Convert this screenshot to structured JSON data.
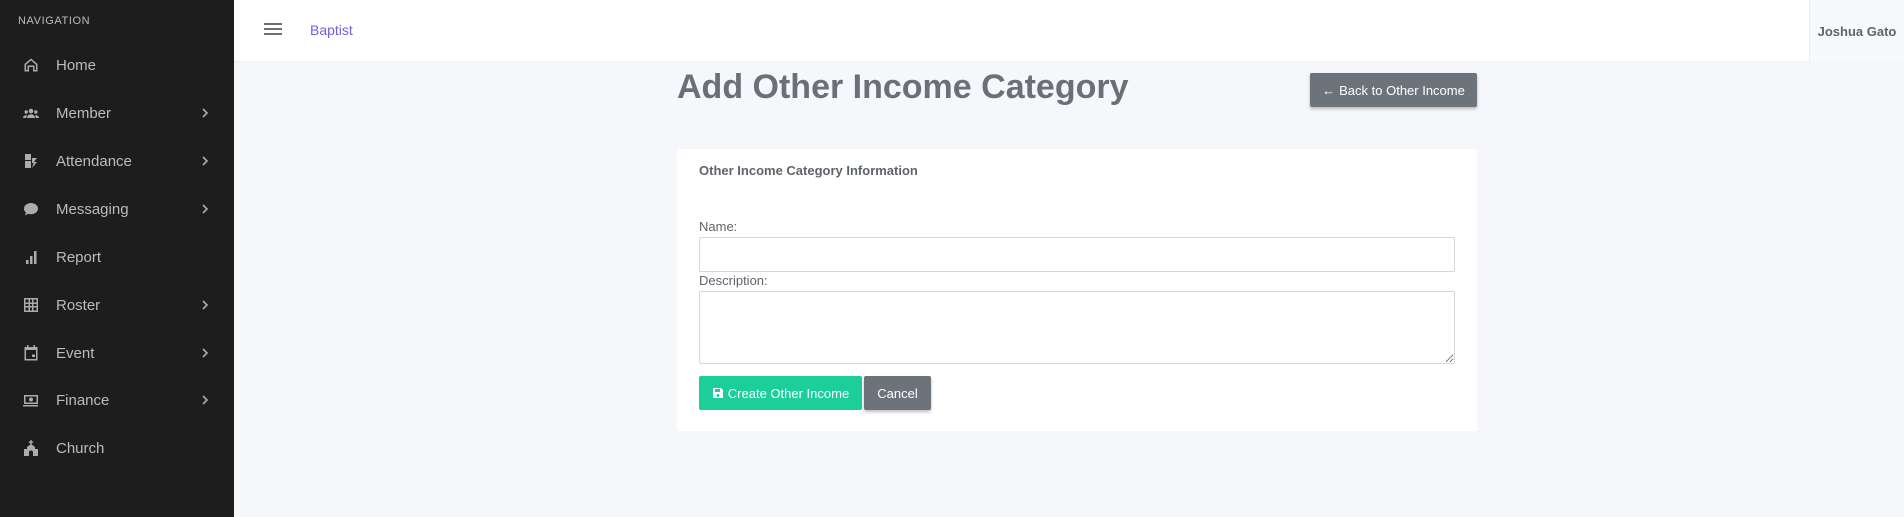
{
  "sidebar": {
    "heading": "NAVIGATION",
    "items": [
      {
        "label": "Home",
        "icon": "home-icon",
        "has_children": false
      },
      {
        "label": "Member",
        "icon": "users-icon",
        "has_children": true
      },
      {
        "label": "Attendance",
        "icon": "attendance-icon",
        "has_children": true
      },
      {
        "label": "Messaging",
        "icon": "chat-icon",
        "has_children": true
      },
      {
        "label": "Report",
        "icon": "bar-chart-icon",
        "has_children": false
      },
      {
        "label": "Roster",
        "icon": "roster-icon",
        "has_children": true
      },
      {
        "label": "Event",
        "icon": "calendar-icon",
        "has_children": true
      },
      {
        "label": "Finance",
        "icon": "money-icon",
        "has_children": true
      },
      {
        "label": "Church",
        "icon": "church-icon",
        "has_children": false
      }
    ]
  },
  "topbar": {
    "brand": "Baptist",
    "user_name": "Joshua Gato"
  },
  "main": {
    "title": "Add Other Income Category",
    "back_button": "Back to Other Income",
    "card": {
      "title": "Other Income Category Information",
      "name_label": "Name:",
      "name_value": "",
      "description_label": "Description:",
      "description_value": "",
      "create_button": "Create Other Income",
      "cancel_button": "Cancel"
    }
  },
  "colors": {
    "sidebar_bg": "#1d1d1d",
    "accent_link": "#6d63d8",
    "create_button": "#1ccf9a",
    "secondary_button": "#6c737b",
    "page_bg": "#f6f7fb"
  }
}
